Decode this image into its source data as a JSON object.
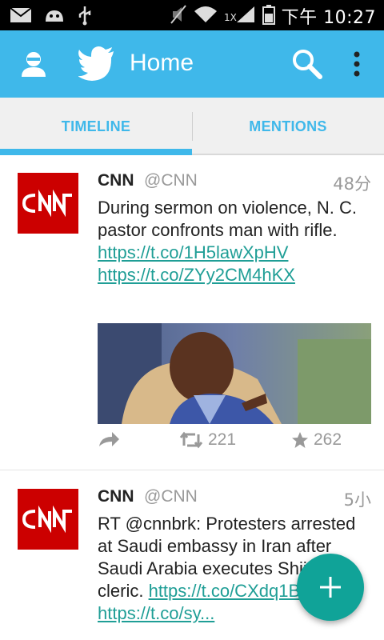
{
  "status_bar": {
    "time": "下午 10:27",
    "icons": [
      "mail-icon",
      "android-icon",
      "usb-icon",
      "mute-icon",
      "wifi-icon",
      "signal-icon",
      "battery-icon"
    ]
  },
  "action_bar": {
    "title": "Home",
    "background": "#3fb8ea",
    "icons": [
      "profile-icon",
      "twitter-bird-icon",
      "search-icon",
      "overflow-menu-icon"
    ]
  },
  "tabs": [
    {
      "label": "TIMELINE",
      "selected": true
    },
    {
      "label": "MENTIONS",
      "selected": false
    }
  ],
  "tweets": [
    {
      "name": "CNN",
      "handle": "@CNN",
      "time": "48分",
      "text": "During sermon on violence, N. C. pastor confronts man with rifle.",
      "links": [
        "https://t.co/1H5lawXpHV",
        "https://t.co/ZYy2CM4hKX"
      ],
      "has_image": true,
      "retweets": "221",
      "favorites": "262"
    },
    {
      "name": "CNN",
      "handle": "@CNN",
      "time": "5小",
      "text": "RT @cnnbrk: Protesters arrested at Saudi embassy in Iran after Saudi Arabia executes Shiite cleric.",
      "link1": "https://t.co/CXdq1Bz5X0",
      "link2": "https://t.co/sy..."
    }
  ],
  "fab": {
    "icon": "plus-icon",
    "color": "#10a398"
  },
  "link_color": "#1f9e96"
}
